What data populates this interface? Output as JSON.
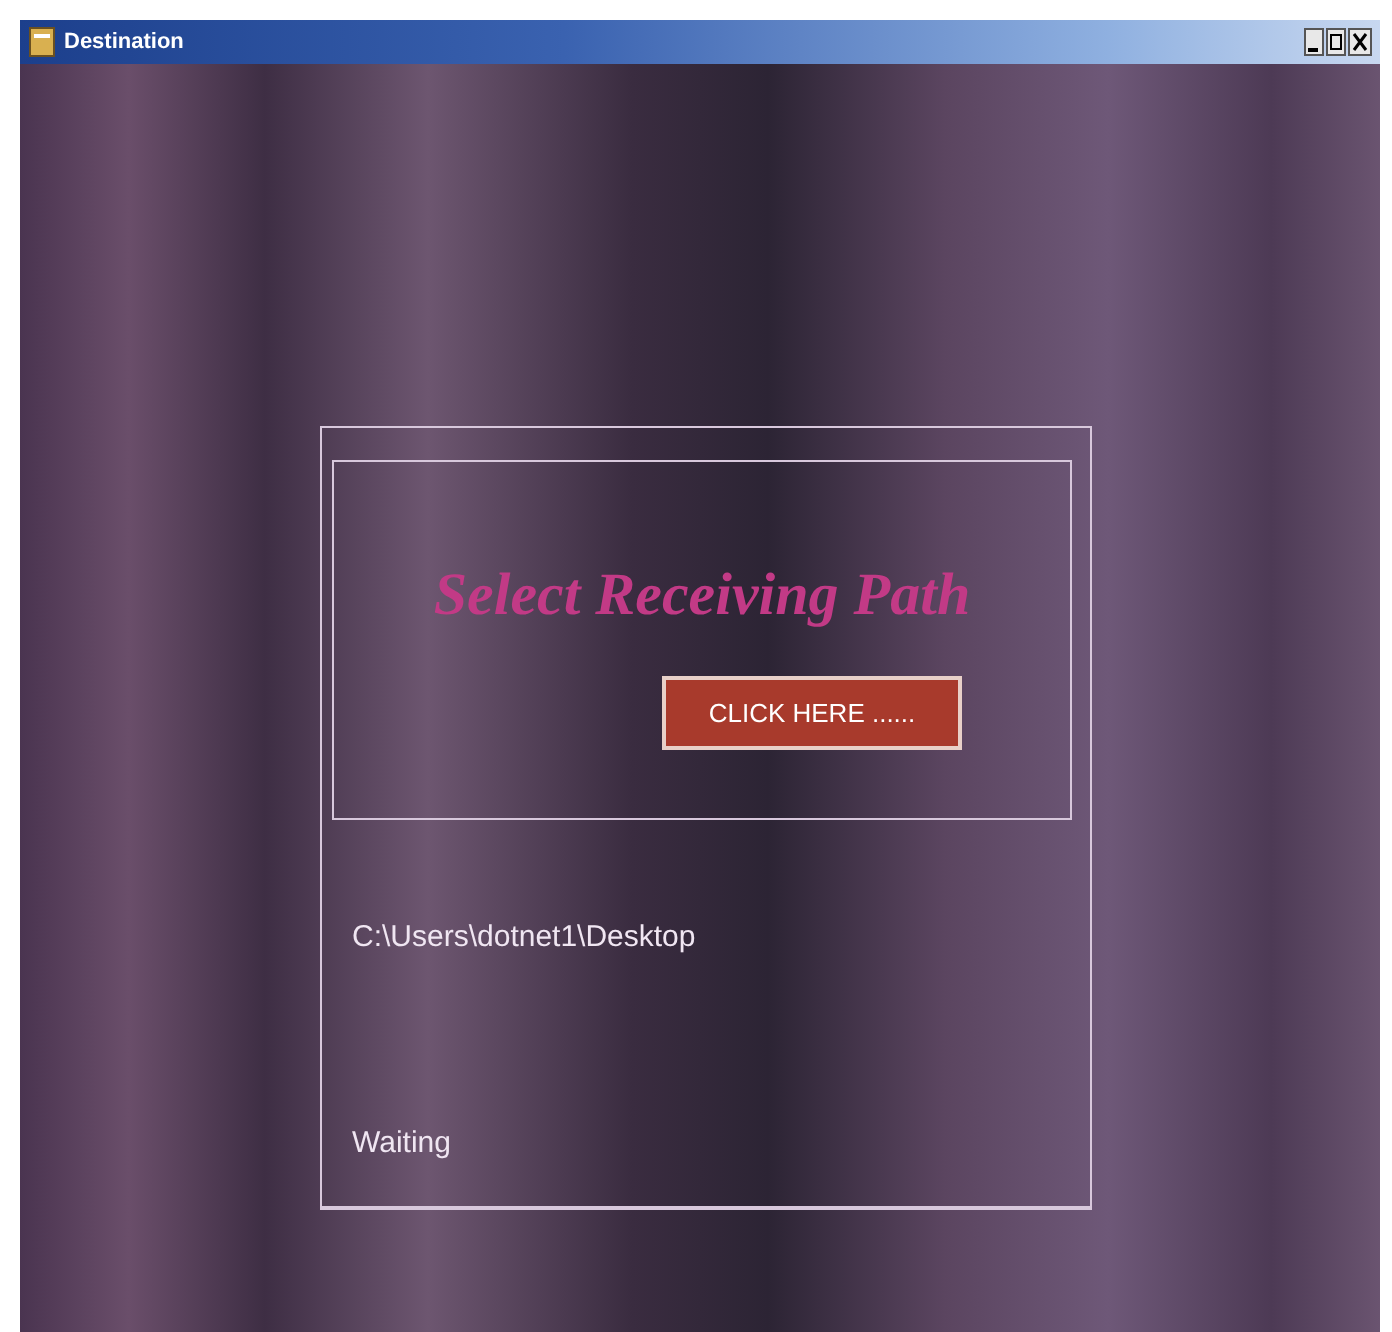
{
  "window": {
    "title": "Destination"
  },
  "heading": "Select Receiving Path",
  "button": {
    "label": "CLICK HERE ......"
  },
  "path_label": "C:\\Users\\dotnet1\\Desktop",
  "status_label": "Waiting"
}
